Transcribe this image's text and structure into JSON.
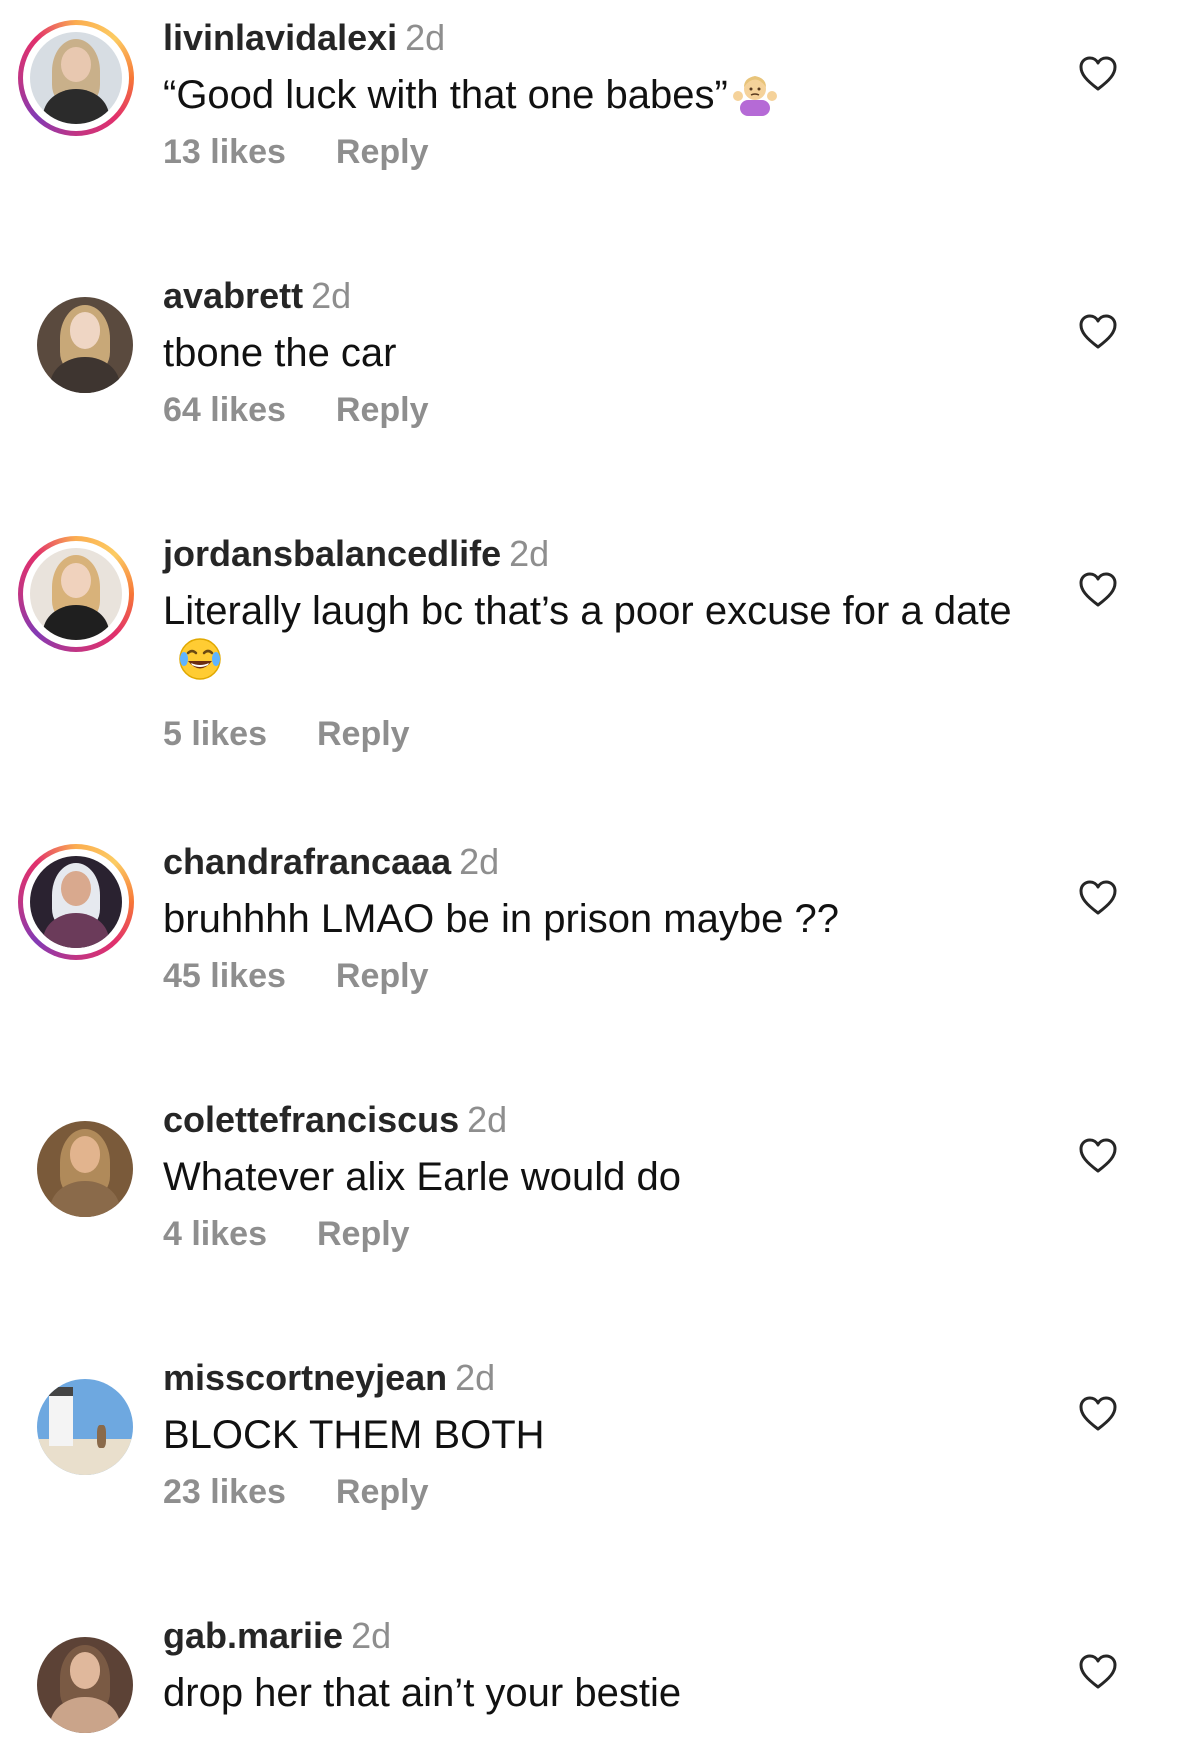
{
  "colors": {
    "username": "#262626",
    "meta_gray": "#8e8e8e",
    "text": "#111111",
    "story_ring_gradient": [
      "#fbad50",
      "#f77737",
      "#e1306c",
      "#c13584",
      "#833ab4"
    ]
  },
  "comments": [
    {
      "username": "livinlavidalexi",
      "time": "2d",
      "text": "“Good luck with that one babes”",
      "emoji": "woman-shrugging-icon",
      "likes": "13 likes",
      "reply": "Reply",
      "story_ring": true
    },
    {
      "username": "avabrett",
      "time": "2d",
      "text": "tbone the car",
      "likes": "64 likes",
      "reply": "Reply",
      "story_ring": false
    },
    {
      "username": "jordansbalancedlife",
      "time": "2d",
      "text": "Literally laugh bc that’s a poor excuse for a date",
      "emoji": "face-with-tears-of-joy-icon",
      "likes": "5 likes",
      "reply": "Reply",
      "story_ring": true
    },
    {
      "username": "chandrafrancaaa",
      "time": "2d",
      "text": "bruhhhh LMAO be in prison maybe ??",
      "likes": "45 likes",
      "reply": "Reply",
      "story_ring": true
    },
    {
      "username": "colettefranciscus",
      "time": "2d",
      "text": "Whatever alix Earle would do",
      "likes": "4 likes",
      "reply": "Reply",
      "story_ring": false
    },
    {
      "username": "misscortneyjean",
      "time": "2d",
      "text": "BLOCK THEM BOTH",
      "likes": "23 likes",
      "reply": "Reply",
      "story_ring": false
    },
    {
      "username": "gab.mariie",
      "time": "2d",
      "text": "drop her that ain’t your bestie",
      "story_ring": false
    }
  ]
}
